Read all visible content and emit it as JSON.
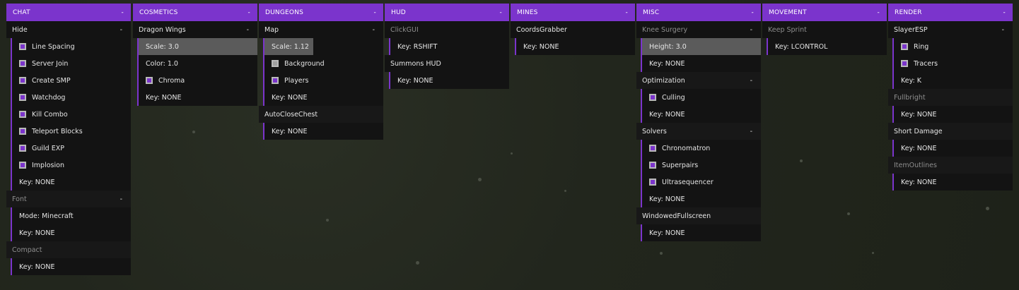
{
  "panels": {
    "chat": {
      "title": "CHAT",
      "collapse": "-",
      "rows": {
        "hide": {
          "label": "Hide",
          "toggle": "-"
        },
        "line_spacing": "Line Spacing",
        "server_join": "Server Join",
        "create_smp": "Create SMP",
        "watchdog": "Watchdog",
        "kill_combo": "Kill Combo",
        "teleport_blocks": "Teleport Blocks",
        "guild_exp": "Guild EXP",
        "implosion": "Implosion",
        "hide_key": "Key: NONE",
        "font": {
          "label": "Font",
          "toggle": "-"
        },
        "font_mode": "Mode: Minecraft",
        "font_key": "Key: NONE",
        "compact": "Compact",
        "compact_key": "Key: NONE"
      }
    },
    "cosmetics": {
      "title": "COSMETICS",
      "collapse": "-",
      "rows": {
        "dragon_wings": {
          "label": "Dragon Wings",
          "toggle": "-"
        },
        "scale": "Scale: 3.0",
        "color": "Color: 1.0",
        "chroma": "Chroma",
        "key": "Key: NONE"
      }
    },
    "dungeons": {
      "title": "DUNGEONS",
      "collapse": "-",
      "rows": {
        "map": {
          "label": "Map",
          "toggle": "-"
        },
        "scale": "Scale: 1.12",
        "background": "Background",
        "players": "Players",
        "map_key": "Key: NONE",
        "autoclosechest": "AutoCloseChest",
        "acc_key": "Key: NONE"
      }
    },
    "hud": {
      "title": "HUD",
      "collapse": "-",
      "rows": {
        "clickgui": "ClickGUI",
        "clickgui_key": "Key: RSHIFT",
        "summons": "Summons HUD",
        "summons_key": "Key: NONE"
      }
    },
    "mines": {
      "title": "MINES",
      "collapse": "-",
      "rows": {
        "coords": "CoordsGrabber",
        "coords_key": "Key: NONE"
      }
    },
    "misc": {
      "title": "MISC",
      "collapse": "-",
      "rows": {
        "knee": {
          "label": "Knee Surgery",
          "toggle": "-"
        },
        "height": "Height: 3.0",
        "knee_key": "Key: NONE",
        "optimization": {
          "label": "Optimization",
          "toggle": "-"
        },
        "culling": "Culling",
        "opt_key": "Key: NONE",
        "solvers": {
          "label": "Solvers",
          "toggle": "-"
        },
        "chrono": "Chronomatron",
        "superpairs": "Superpairs",
        "ultra": "Ultrasequencer",
        "solvers_key": "Key: NONE",
        "windowed": "WindowedFullscreen",
        "windowed_key": "Key: NONE"
      }
    },
    "movement": {
      "title": "MOVEMENT",
      "collapse": "-",
      "rows": {
        "keep_sprint": "Keep Sprint",
        "ks_key": "Key: LCONTROL"
      }
    },
    "render": {
      "title": "RENDER",
      "collapse": "-",
      "rows": {
        "slayeresp": {
          "label": "SlayerESP",
          "toggle": "-"
        },
        "ring": "Ring",
        "tracers": "Tracers",
        "slayer_key": "Key: K",
        "fullbright": "Fullbright",
        "fb_key": "Key: NONE",
        "short_damage": "Short Damage",
        "sd_key": "Key: NONE",
        "itemoutlines": "ItemOutlines",
        "io_key": "Key: NONE"
      }
    }
  },
  "colors": {
    "accent": "#7b34cc",
    "panel_bg": "#131313",
    "slider_fill": "#5b5b5b"
  }
}
